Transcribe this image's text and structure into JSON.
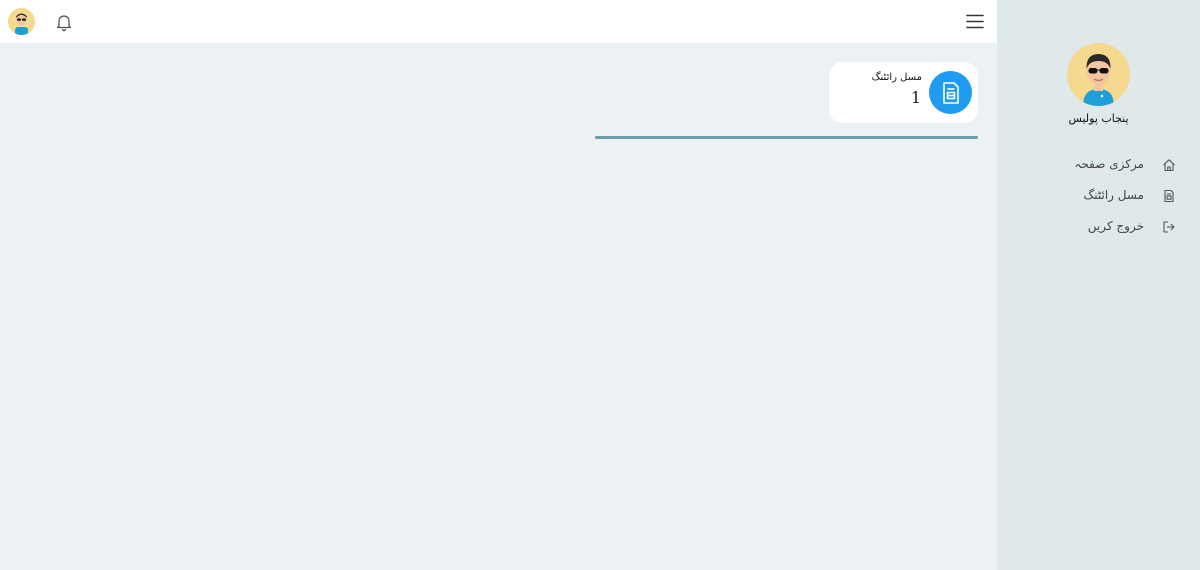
{
  "header": {
    "menu_icon": "hamburger-icon",
    "notification_icon": "bell-icon",
    "avatar_icon": "user-avatar"
  },
  "sidebar": {
    "username": "پنجاب پولیس",
    "items": [
      {
        "label": "مرکزی صفحہ",
        "icon": "home-icon"
      },
      {
        "label": "مسل رائٹنگ",
        "icon": "document-icon"
      },
      {
        "label": "خروج کریں",
        "icon": "logout-icon"
      }
    ]
  },
  "card": {
    "title": "مسل رائٹنگ",
    "count": "1",
    "icon": "document-icon",
    "accent_color": "#1f9bf0"
  },
  "colors": {
    "sidebar_bg": "#dfe9ea",
    "page_bg": "#ecf2f4",
    "progress": "#6a9da8"
  }
}
